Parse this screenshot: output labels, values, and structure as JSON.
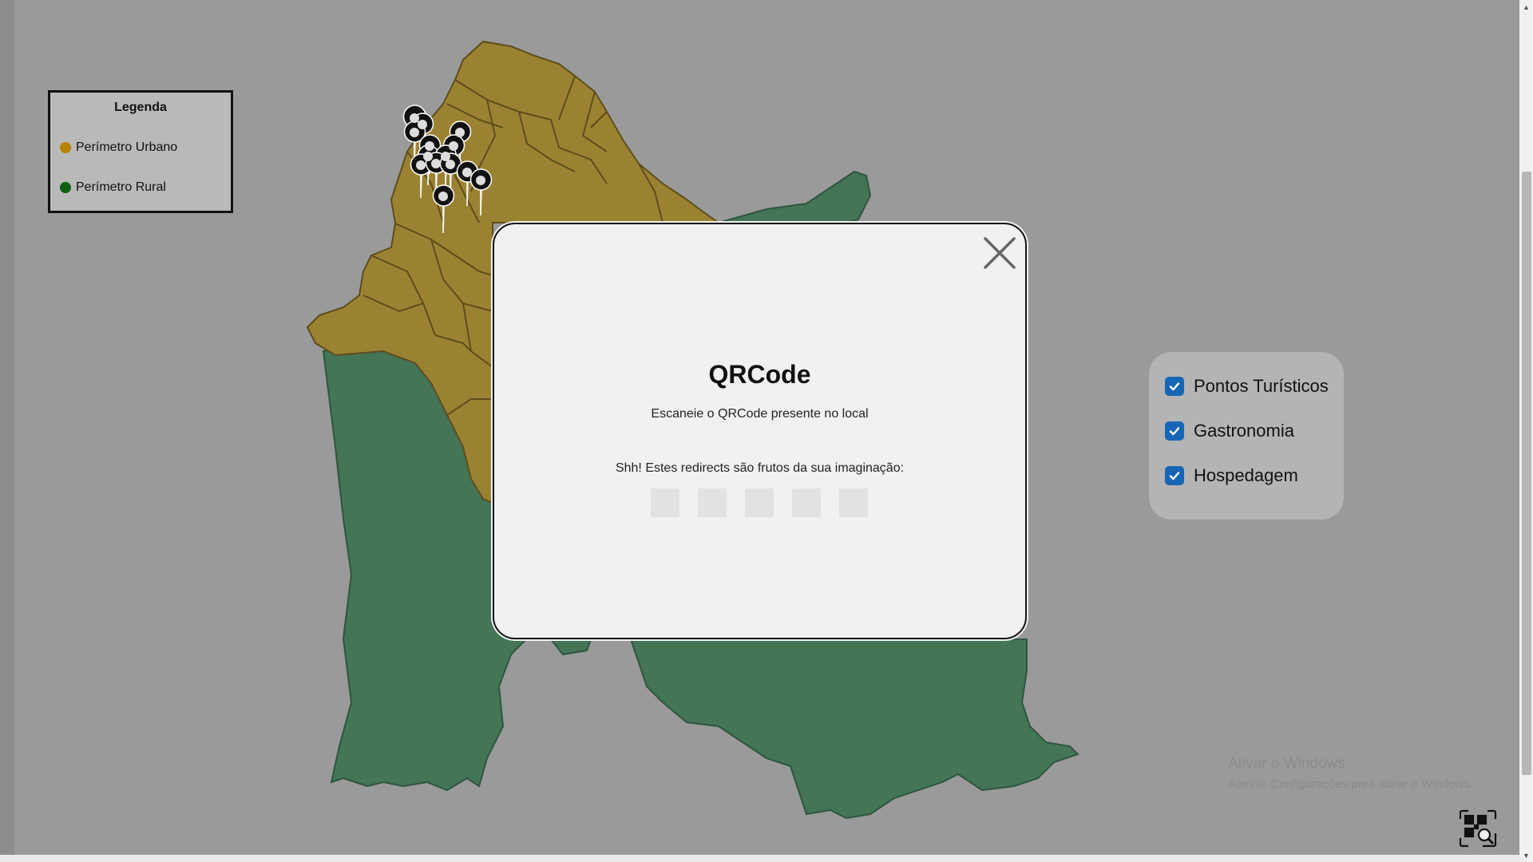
{
  "legend": {
    "title": "Legenda",
    "items": [
      {
        "label": "Perímetro Urbano",
        "color": "#b88300"
      },
      {
        "label": "Perímetro Rural",
        "color": "#0f5f12"
      }
    ]
  },
  "filters": [
    {
      "label": "Pontos Turísticos",
      "checked": true
    },
    {
      "label": "Gastronomia",
      "checked": true
    },
    {
      "label": "Hospedagem",
      "checked": true
    }
  ],
  "modal": {
    "title": "QRCode",
    "subtitle": "Escaneie o QRCode presente no local",
    "hint": "Shh! Estes redirects são frutos da sua imaginação:",
    "code_slots": [
      "",
      "",
      "",
      "",
      ""
    ]
  },
  "watermark": {
    "line1": "Ativar o Windows",
    "line2": "Acesse Configurações para ativar o Windows."
  },
  "colors": {
    "urban": "#9b8232",
    "rural": "#437556",
    "accent": "#1766b5"
  },
  "icons": {
    "close": "close-icon",
    "checkbox": "check-icon",
    "qr_scan": "qr-scan-icon",
    "marker": "map-marker-icon"
  }
}
